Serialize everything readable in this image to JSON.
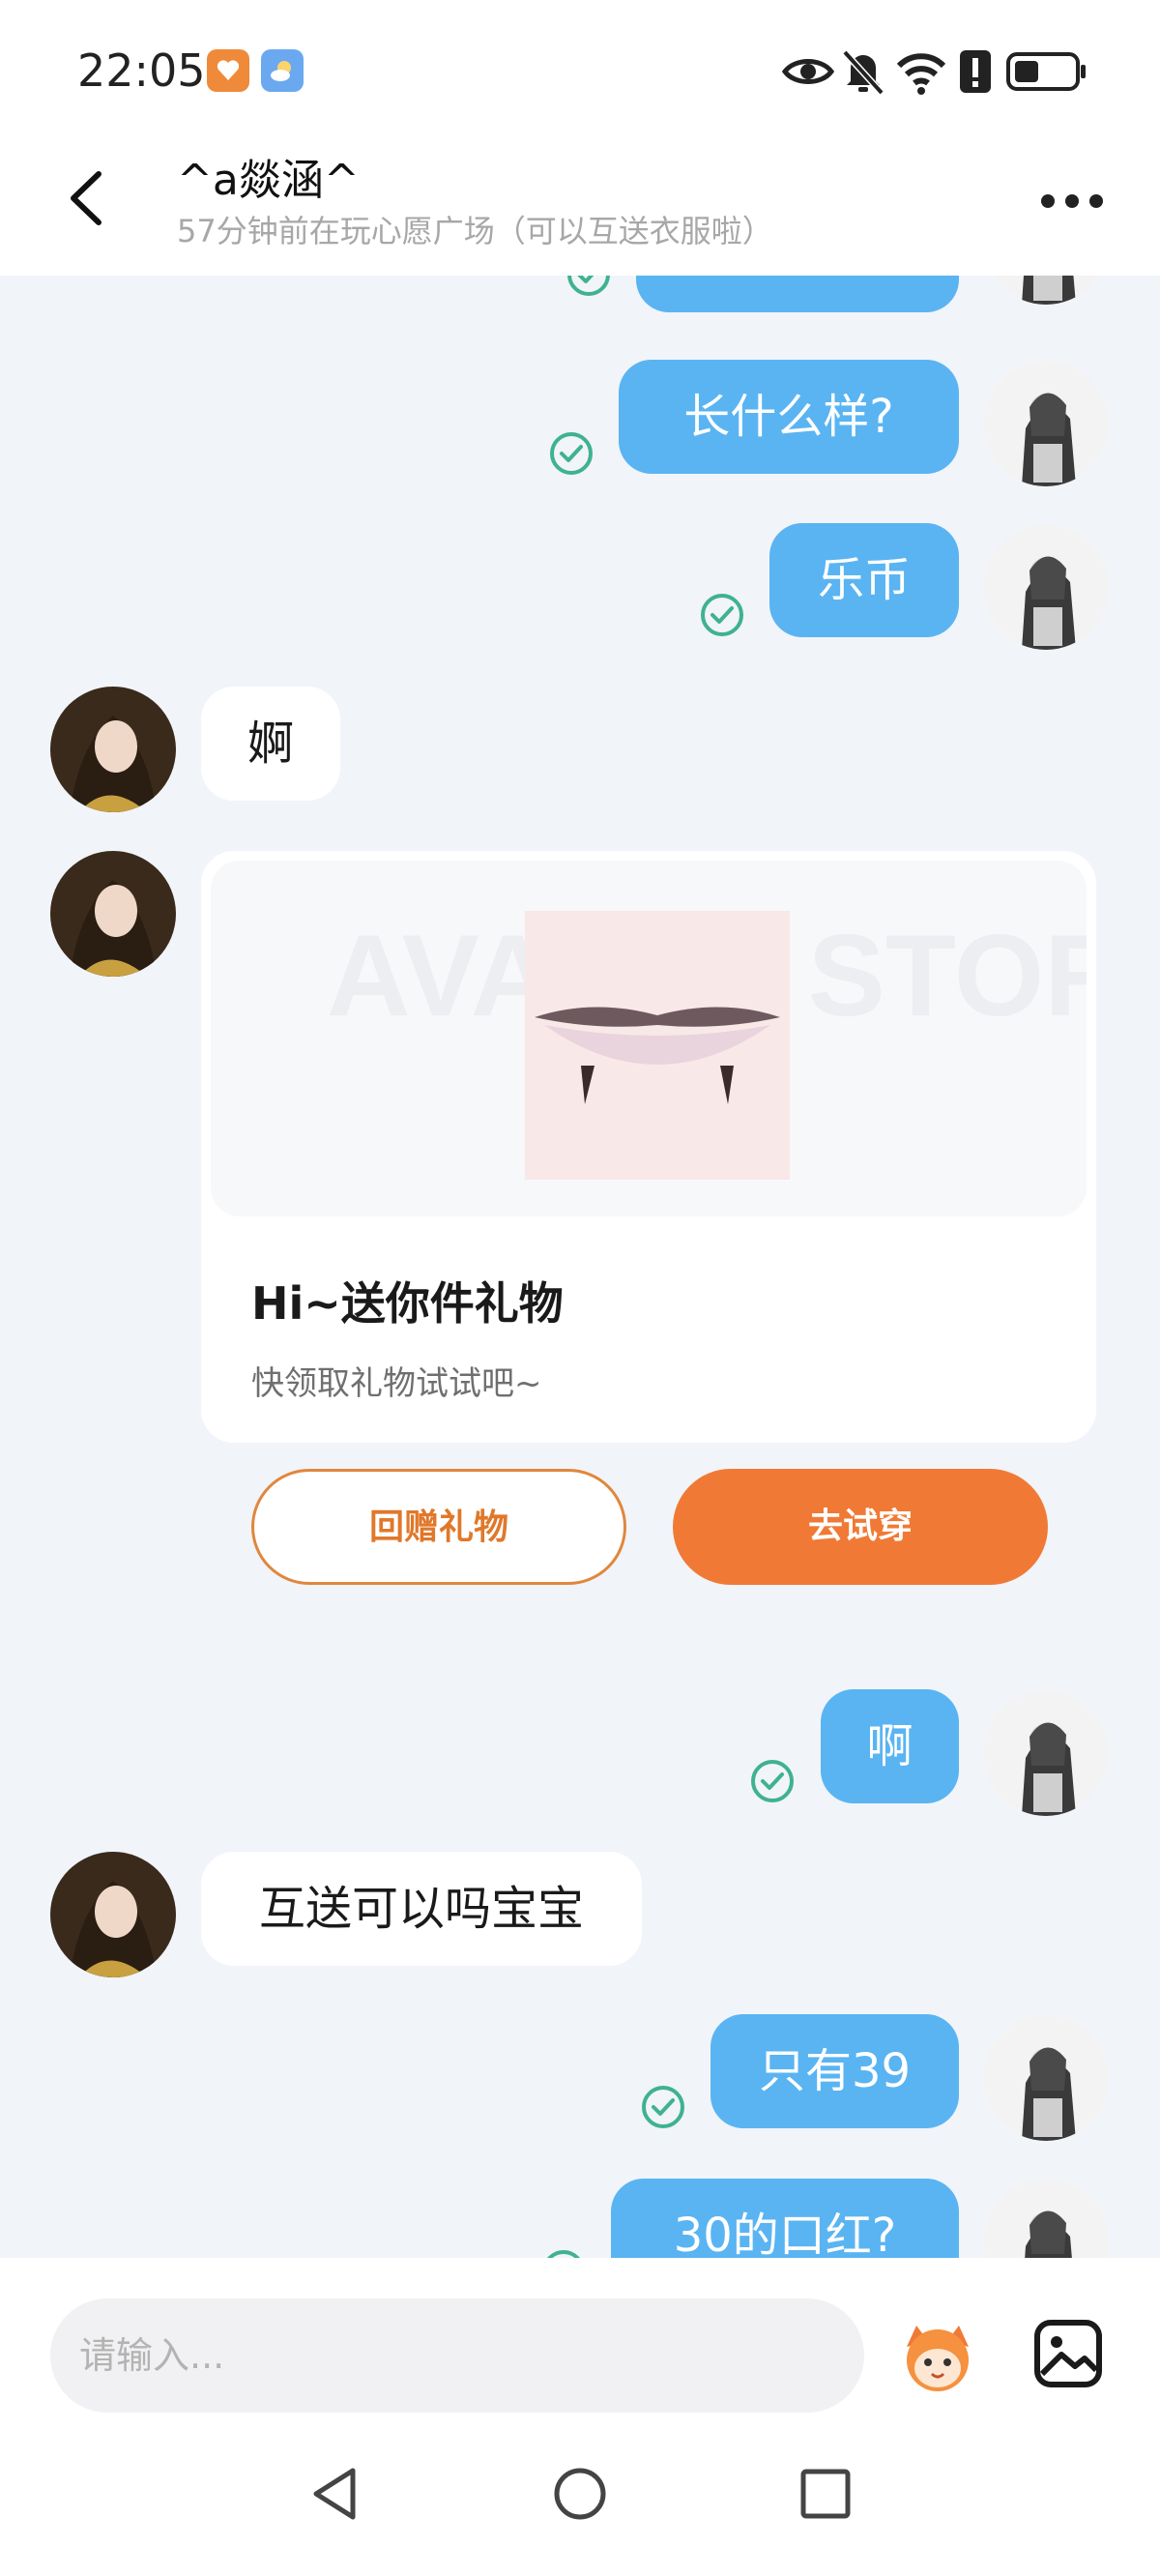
{
  "status_bar": {
    "time": "22:05",
    "icons": [
      "health-app-icon",
      "weather-app-icon",
      "eye-icon",
      "mute-icon",
      "wifi-icon",
      "alert-icon",
      "battery-icon"
    ]
  },
  "header": {
    "title": "^a燚涵^",
    "subtitle": "57分钟前在玩心愿广场（可以互送衣服啦）"
  },
  "messages": [
    {
      "from": "me",
      "text": "",
      "read": true
    },
    {
      "from": "me",
      "text": "长什么样?",
      "read": true
    },
    {
      "from": "me",
      "text": "乐币",
      "read": true
    },
    {
      "from": "them",
      "text": "婀"
    },
    {
      "from": "them",
      "type": "gift-card"
    },
    {
      "from": "me",
      "text": "啊",
      "read": true
    },
    {
      "from": "them",
      "text": "互送可以吗宝宝"
    },
    {
      "from": "me",
      "text": "只有39",
      "read": true
    },
    {
      "from": "me",
      "text": "30的口红?",
      "read": true
    }
  ],
  "gift_card": {
    "watermark": "AVATAR STORE",
    "title": "Hi~送你件礼物",
    "subtitle": "快领取礼物试试吧~",
    "return_button": "回赠礼物",
    "try_button": "去试穿"
  },
  "input": {
    "placeholder": "请输入..."
  },
  "colors": {
    "my_bubble": "#5ab4f2",
    "their_bubble": "#ffffff",
    "accent_orange": "#f07a35",
    "read_check": "#3fb28f",
    "background": "#f1f4f9"
  }
}
